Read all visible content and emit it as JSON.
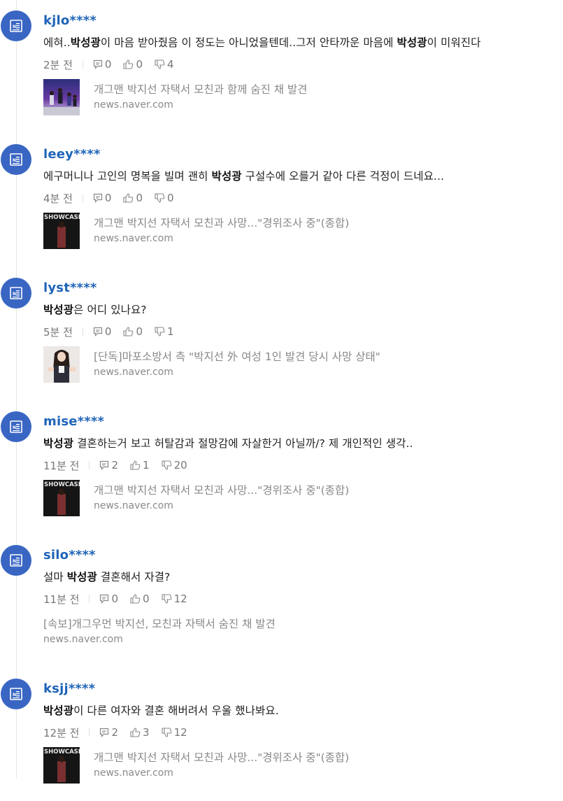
{
  "comments": [
    {
      "username": "kjlo****",
      "text_parts": [
        "에혀..",
        "박성광",
        "이 마음 받아줬음 이 정도는 아니었을텐데..그저 안타까운 마음에 ",
        "박성광",
        "이 미워진다"
      ],
      "time": "2분 전",
      "replies": "0",
      "likes": "0",
      "dislikes": "4",
      "article": {
        "title": "개그맨 박지선 자택서 모친과 함께 숨진 채 발견",
        "source": "news.naver.com",
        "thumbnail": "stage-group"
      }
    },
    {
      "username": "leey****",
      "text_parts": [
        "에구머니나 고인의 명복을 빌며 괜히 ",
        "박성광",
        " 구설수에 오를거 같아 다른 걱정이 드네요...",
        "",
        ""
      ],
      "time": "4분 전",
      "replies": "0",
      "likes": "0",
      "dislikes": "0",
      "article": {
        "title": "개그맨 박지선 자택서 모친과 사망...\"경위조사 중\"(종합)",
        "source": "news.naver.com",
        "thumbnail": "showcase"
      }
    },
    {
      "username": "lyst****",
      "text_parts": [
        "",
        "박성광",
        "은 어디 있나요?",
        "",
        ""
      ],
      "time": "5분 전",
      "replies": "0",
      "likes": "0",
      "dislikes": "1",
      "article": {
        "title": "[단독]마포소방서 측 \"박지선 外 여성 1인 발견 당시 사망 상태\"",
        "source": "news.naver.com",
        "thumbnail": "woman"
      }
    },
    {
      "username": "mise****",
      "text_parts": [
        "",
        "박성광",
        " 결혼하는거 보고 허탈감과 절망감에 자살한거 아닐까/? 제 개인적인 생각..",
        "",
        ""
      ],
      "time": "11분 전",
      "replies": "2",
      "likes": "1",
      "dislikes": "20",
      "article": {
        "title": "개그맨 박지선 자택서 모친과 사망...\"경위조사 중\"(종합)",
        "source": "news.naver.com",
        "thumbnail": "showcase"
      }
    },
    {
      "username": "silo****",
      "text_parts": [
        "설마 ",
        "박성광",
        " 결혼해서 자결?",
        "",
        ""
      ],
      "time": "11분 전",
      "replies": "0",
      "likes": "0",
      "dislikes": "12",
      "article": {
        "title": "[속보]개그우먼 박지선, 모친과 자택서 숨진 채 발견",
        "source": "news.naver.com",
        "thumbnail": ""
      }
    },
    {
      "username": "ksjj****",
      "text_parts": [
        "",
        "박성광",
        "이 다른 여자와 결혼 해버려서 우울 했나봐요.",
        "",
        ""
      ],
      "time": "12분 전",
      "replies": "2",
      "likes": "3",
      "dislikes": "12",
      "article": {
        "title": "개그맨 박지선 자택서 모친과 사망...\"경위조사 중\"(종합)",
        "source": "news.naver.com",
        "thumbnail": "showcase"
      }
    }
  ],
  "thumb_text": {
    "showcase": "SHOWCASE"
  },
  "colors": {
    "avatar": "#3a66c3",
    "username": "#1f64b8",
    "meta": "#777777"
  }
}
